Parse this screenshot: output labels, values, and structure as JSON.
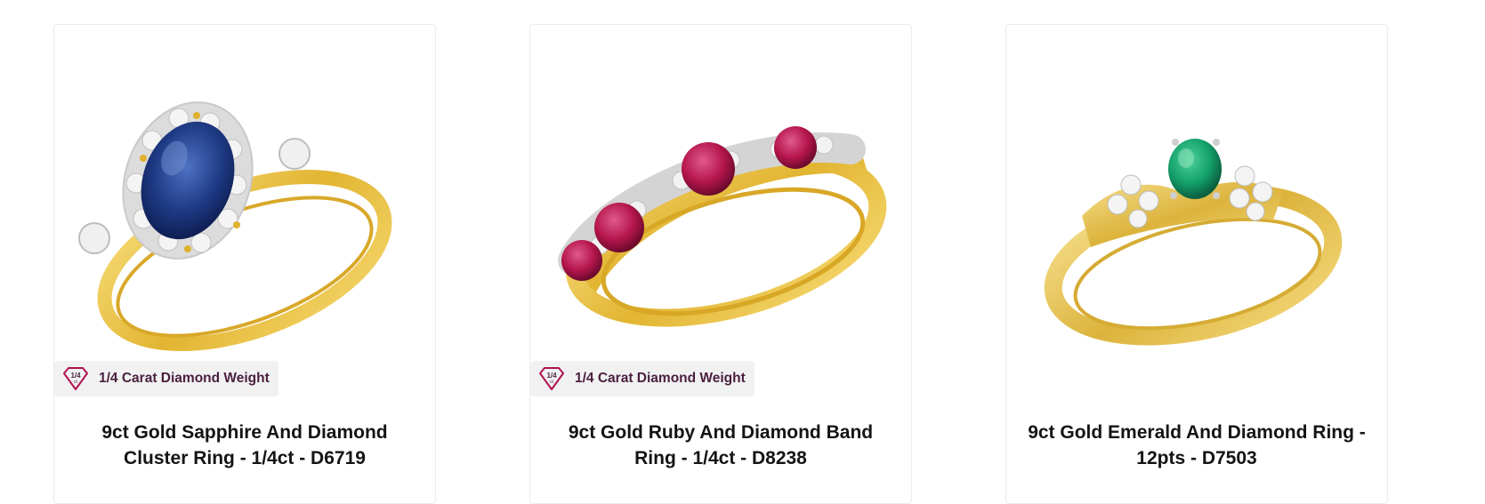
{
  "products": [
    {
      "title": "9ct Gold Sapphire And Diamond Cluster Ring - 1/4ct - D6719",
      "badge": {
        "fraction": "1/4",
        "unit": "ct",
        "label": "1/4 Carat Diamond Weight"
      },
      "stone": "sapphire"
    },
    {
      "title": "9ct Gold Ruby And Diamond Band Ring - 1/4ct - D8238",
      "badge": {
        "fraction": "1/4",
        "unit": "ct",
        "label": "1/4 Carat Diamond Weight"
      },
      "stone": "ruby"
    },
    {
      "title": "9ct Gold Emerald And Diamond Ring - 12pts - D7503",
      "stone": "emerald"
    }
  ],
  "colors": {
    "badge_text": "#4a1f3e",
    "badge_bg": "#f1f1f2",
    "gold": "#e8c24a",
    "sapphire": "#1f3b86",
    "ruby": "#b5164d",
    "emerald": "#14a06b"
  }
}
